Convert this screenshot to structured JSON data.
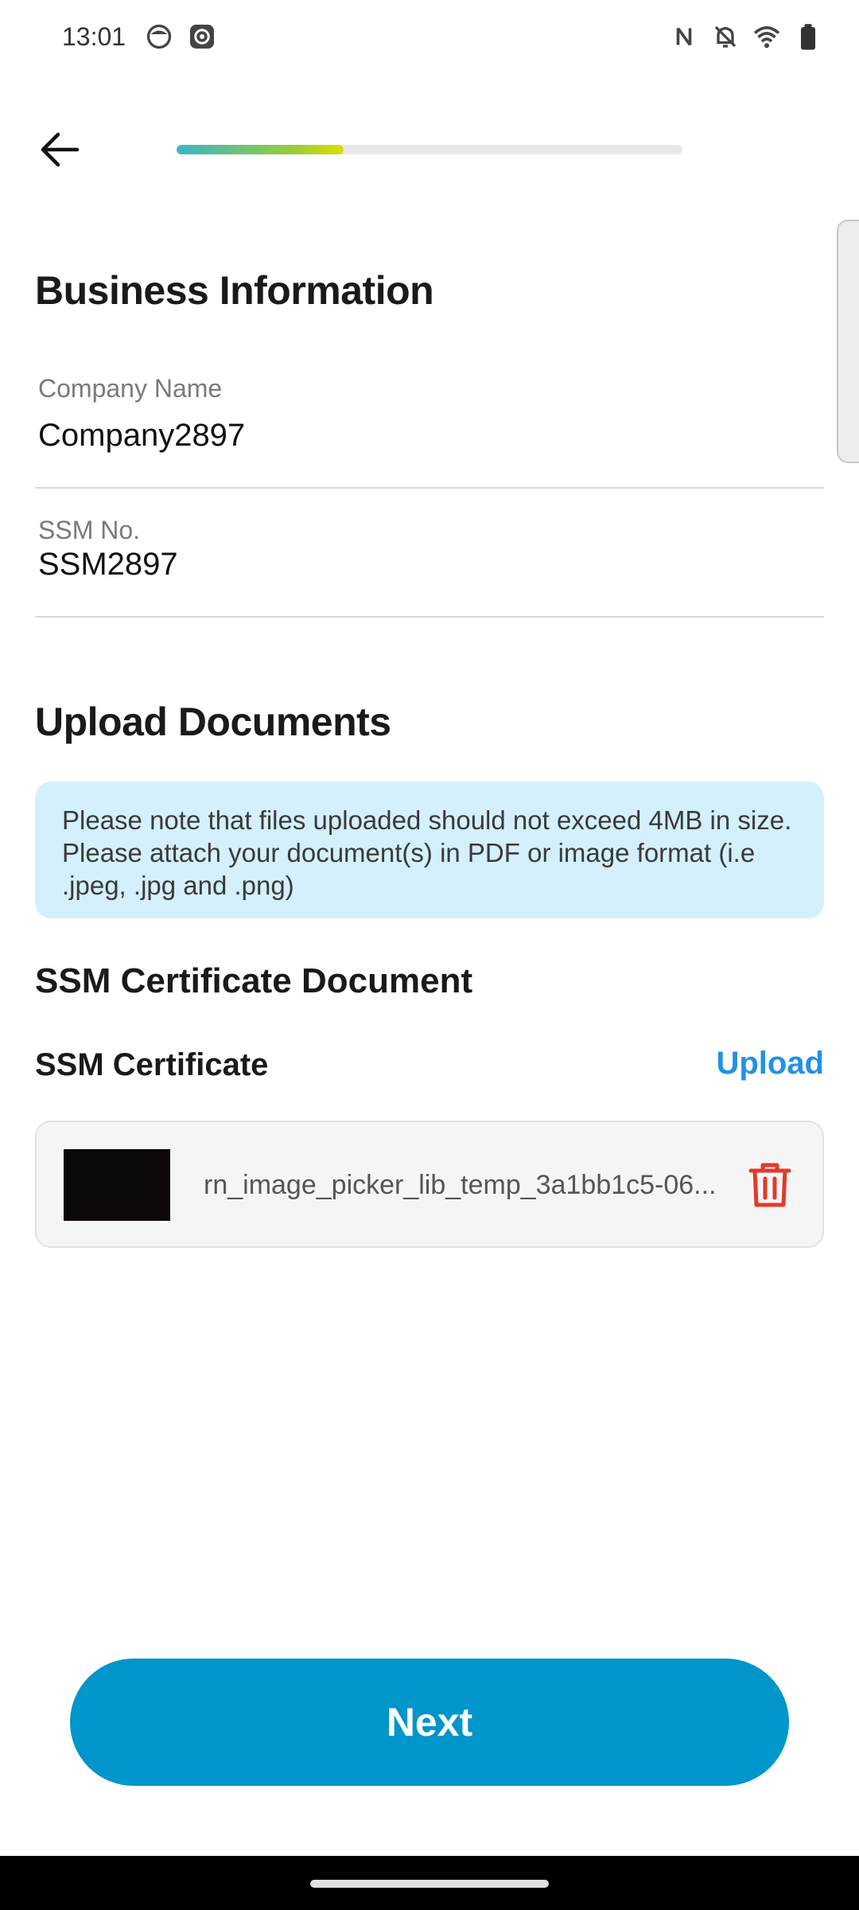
{
  "status_bar": {
    "time": "13:01"
  },
  "progress": {
    "value_percent": 33
  },
  "business": {
    "title": "Business Information",
    "company_name_label": "Company Name",
    "company_name_value": "Company2897",
    "ssm_no_label": "SSM No.",
    "ssm_no_value": "SSM2897"
  },
  "documents": {
    "title": "Upload Documents",
    "notice": "Please note that files uploaded should not exceed 4MB in size. Please attach your document(s) in PDF or image format (i.e .jpeg, .jpg and .png)",
    "ssm_doc_title": "SSM Certificate Document",
    "ssm_cert_label": "SSM Certificate",
    "upload_label": "Upload",
    "file_name": "rn_image_picker_lib_temp_3a1bb1c5-06..."
  },
  "footer": {
    "next_label": "Next"
  },
  "colors": {
    "accent": "#0095cb",
    "link": "#2490e6",
    "danger": "#e23a2a",
    "notice_bg": "#d3f0fc"
  }
}
